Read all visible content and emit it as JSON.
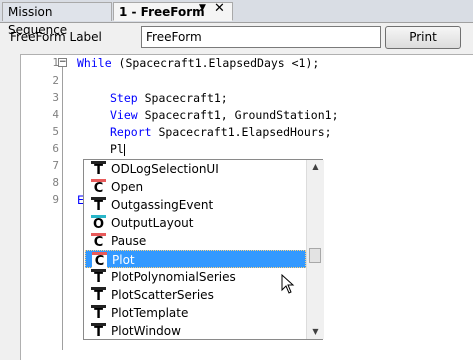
{
  "tabs": [
    {
      "label": "Mission Sequence"
    },
    {
      "label": "1 - FreeForm"
    }
  ],
  "tab_controls": {
    "dropdown_glyph": "▼",
    "close_glyph": "✕"
  },
  "label_row": {
    "label": "FreeForm Label",
    "value": "FreeForm",
    "print_label": "Print"
  },
  "editor": {
    "fold_glyph": "−",
    "line_numbers": [
      "1",
      "2",
      "3",
      "4",
      "5",
      "6",
      "7",
      "8",
      "9"
    ],
    "lines": [
      {
        "kw": "While",
        "text": " (Spacecraft1.ElapsedDays <1);"
      },
      {
        "kw": "",
        "text": ""
      },
      {
        "kw": "Step",
        "text": " Spacecraft1;"
      },
      {
        "kw": "View",
        "text": " Spacecraft1, GroundStation1;"
      },
      {
        "kw": "Report",
        "text": " Spacecraft1.ElapsedHours;"
      },
      {
        "kw": "",
        "text": "Pl"
      },
      {
        "kw": "",
        "text": ""
      },
      {
        "kw": "",
        "text": ""
      },
      {
        "kw": "E",
        "text": ""
      }
    ]
  },
  "autocomplete": {
    "items": [
      {
        "icon": "T",
        "label": "ODLogSelectionUI"
      },
      {
        "icon": "C",
        "label": "Open"
      },
      {
        "icon": "T",
        "label": "OutgassingEvent"
      },
      {
        "icon": "O",
        "label": "OutputLayout"
      },
      {
        "icon": "C",
        "label": "Pause"
      },
      {
        "icon": "C",
        "label": "Plot",
        "selected": true
      },
      {
        "icon": "T",
        "label": "PlotPolynomialSeries"
      },
      {
        "icon": "T",
        "label": "PlotScatterSeries"
      },
      {
        "icon": "T",
        "label": "PlotTemplate"
      },
      {
        "icon": "T",
        "label": "PlotWindow"
      }
    ],
    "scroll_up_glyph": "▲",
    "scroll_down_glyph": "▼"
  }
}
